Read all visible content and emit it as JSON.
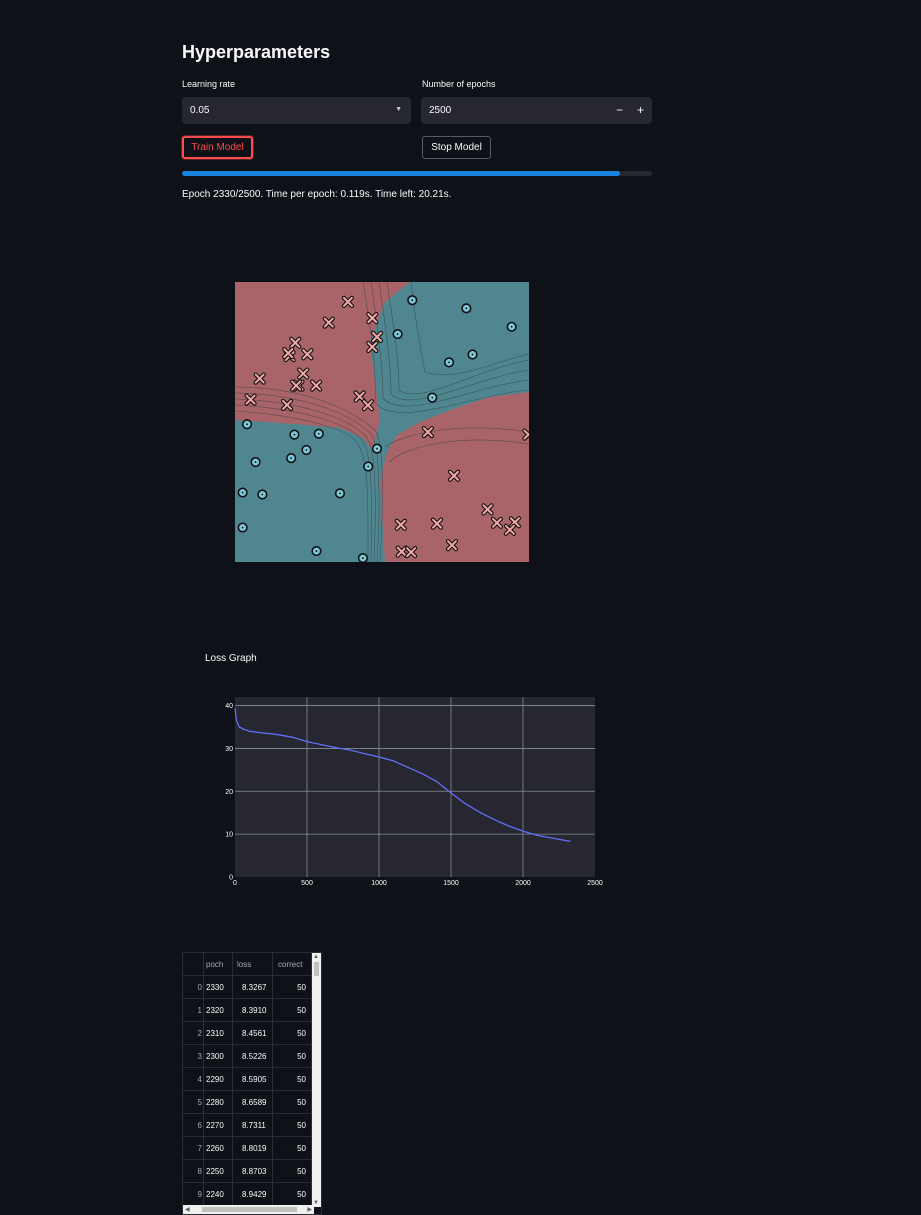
{
  "header": {
    "title": "Hyperparameters"
  },
  "controls": {
    "learning_rate": {
      "label": "Learning rate",
      "value": "0.05",
      "icon": "chevron-down-icon"
    },
    "epochs": {
      "label": "Number of epochs",
      "value": "2500",
      "minus": "−",
      "plus": "+"
    },
    "train_button": "Train Model",
    "stop_button": "Stop Model"
  },
  "progress": {
    "fraction": 0.932,
    "status": "Epoch 2330/2500. Time per epoch: 0.119s. Time left: 20.21s."
  },
  "colors": {
    "accent_red": "#ff4b4b",
    "progress_blue": "#1c83e1",
    "line_color": "#636efa",
    "region_red": "#a86468",
    "region_teal": "#4f8690",
    "background": "#0e1117"
  },
  "loss_graph": {
    "title": "Loss Graph"
  },
  "chart_data": [
    {
      "type": "scatter",
      "description_of_marks": "decision boundary contour with two classes",
      "xlim": [
        0,
        1
      ],
      "ylim": [
        0,
        1
      ],
      "regions": [
        {
          "class": "x",
          "color": "#a86468"
        },
        {
          "class": "o",
          "color": "#4f8690"
        }
      ],
      "series": [
        {
          "marker": "x",
          "points": [
            [
              0.384,
              0.929
            ],
            [
              0.319,
              0.855
            ],
            [
              0.467,
              0.871
            ],
            [
              0.483,
              0.804
            ],
            [
              0.467,
              0.768
            ],
            [
              0.205,
              0.783
            ],
            [
              0.186,
              0.735
            ],
            [
              0.246,
              0.742
            ],
            [
              0.181,
              0.746
            ],
            [
              0.232,
              0.673
            ],
            [
              0.216,
              0.63
            ],
            [
              0.276,
              0.63
            ],
            [
              0.208,
              0.63
            ],
            [
              0.084,
              0.655
            ],
            [
              0.053,
              0.58
            ],
            [
              0.177,
              0.561
            ],
            [
              0.424,
              0.591
            ],
            [
              0.452,
              0.56
            ],
            [
              0.656,
              0.464
            ],
            [
              0.998,
              0.455
            ],
            [
              0.745,
              0.308
            ],
            [
              0.859,
              0.188
            ],
            [
              0.891,
              0.14
            ],
            [
              0.952,
              0.142
            ],
            [
              0.935,
              0.115
            ],
            [
              0.687,
              0.137
            ],
            [
              0.564,
              0.133
            ],
            [
              0.738,
              0.06
            ],
            [
              0.567,
              0.037
            ],
            [
              0.599,
              0.035
            ]
          ]
        },
        {
          "marker": "o",
          "points": [
            [
              0.603,
              0.935
            ],
            [
              0.787,
              0.906
            ],
            [
              0.941,
              0.84
            ],
            [
              0.553,
              0.814
            ],
            [
              0.808,
              0.741
            ],
            [
              0.728,
              0.713
            ],
            [
              0.671,
              0.587
            ],
            [
              0.041,
              0.492
            ],
            [
              0.202,
              0.455
            ],
            [
              0.285,
              0.458
            ],
            [
              0.483,
              0.405
            ],
            [
              0.243,
              0.4
            ],
            [
              0.191,
              0.371
            ],
            [
              0.07,
              0.357
            ],
            [
              0.453,
              0.341
            ],
            [
              0.026,
              0.248
            ],
            [
              0.093,
              0.241
            ],
            [
              0.357,
              0.245
            ],
            [
              0.026,
              0.123
            ],
            [
              0.277,
              0.039
            ],
            [
              0.435,
              0.014
            ]
          ]
        }
      ]
    },
    {
      "type": "line",
      "title": "Loss Graph",
      "xlim": [
        0,
        2500
      ],
      "ylim": [
        0,
        42
      ],
      "xticks": [
        0,
        500,
        1000,
        1500,
        2000,
        2500
      ],
      "yticks": [
        0,
        10,
        20,
        30,
        40
      ],
      "grid": true,
      "series": [
        {
          "x": [
            0,
            10,
            30,
            60,
            100,
            200,
            300,
            400,
            500,
            600,
            700,
            800,
            900,
            1000,
            1100,
            1200,
            1300,
            1400,
            1500,
            1600,
            1700,
            1800,
            1900,
            2000,
            2100,
            2200,
            2330
          ],
          "y": [
            39.5,
            36.5,
            35.0,
            34.5,
            34.0,
            33.6,
            33.2,
            32.6,
            31.6,
            30.9,
            30.2,
            29.6,
            28.8,
            28.0,
            27.1,
            25.6,
            24.1,
            22.3,
            19.6,
            17.1,
            15.1,
            13.4,
            11.9,
            10.7,
            9.7,
            9.1,
            8.3
          ]
        }
      ]
    }
  ],
  "table": {
    "columns": [
      "",
      "poch",
      "loss",
      "correct"
    ],
    "rows": [
      [
        "0",
        "2330",
        "8.3267",
        "50"
      ],
      [
        "1",
        "2320",
        "8.3910",
        "50"
      ],
      [
        "2",
        "2310",
        "8.4561",
        "50"
      ],
      [
        "3",
        "2300",
        "8.5226",
        "50"
      ],
      [
        "4",
        "2290",
        "8.5905",
        "50"
      ],
      [
        "5",
        "2280",
        "8.6589",
        "50"
      ],
      [
        "6",
        "2270",
        "8.7311",
        "50"
      ],
      [
        "7",
        "2260",
        "8.8019",
        "50"
      ],
      [
        "8",
        "2250",
        "8.8703",
        "50"
      ],
      [
        "9",
        "2240",
        "8.9429",
        "50"
      ]
    ]
  }
}
